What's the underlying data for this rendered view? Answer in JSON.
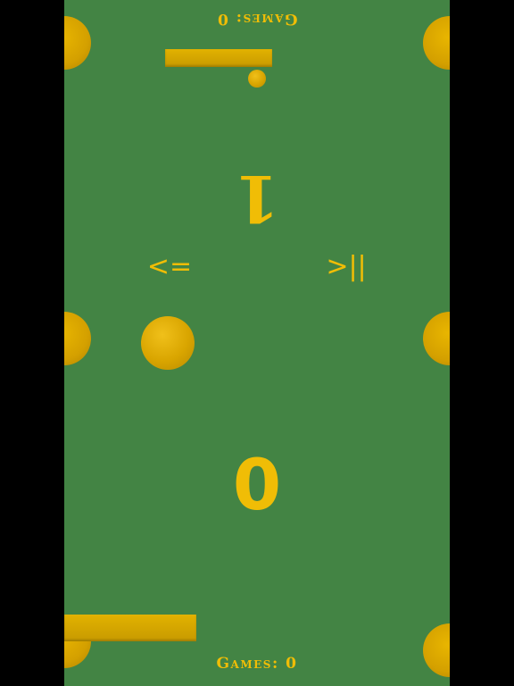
{
  "top_player": {
    "games_label": "Games: 0",
    "score": "1"
  },
  "bottom_player": {
    "games_label": "Games: 0",
    "score": "0"
  },
  "controls": {
    "back_label": "<=",
    "play_pause_label": ">||"
  },
  "colors": {
    "field": "#438444",
    "accent": "#f0bd06",
    "frame": "#000000"
  }
}
